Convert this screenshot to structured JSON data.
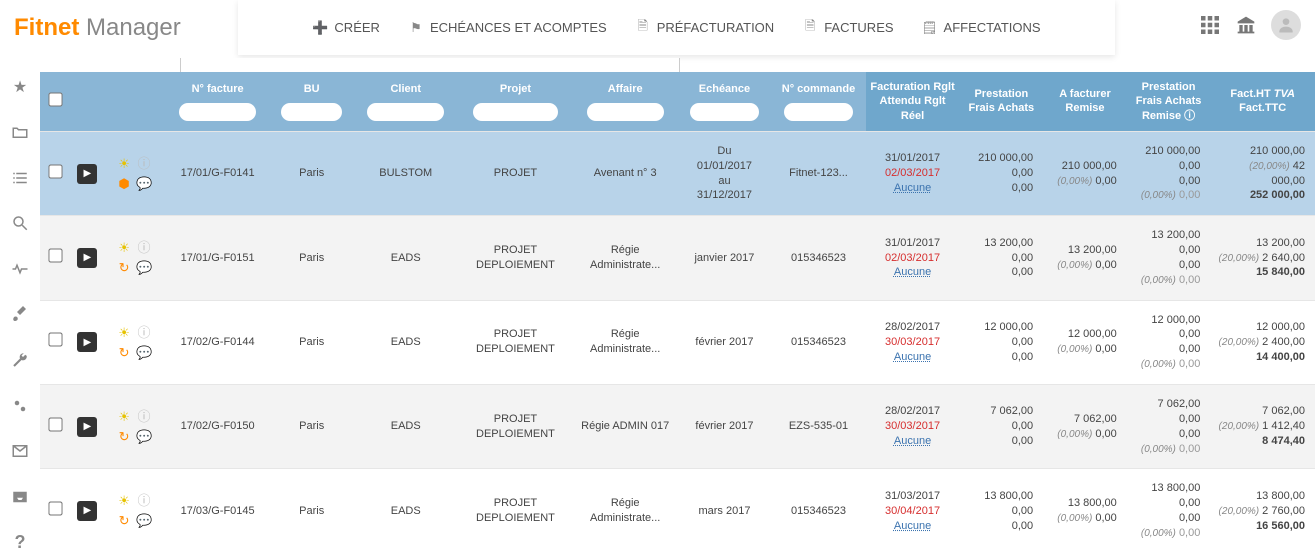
{
  "logo": {
    "brand1": "Fitnet",
    "brand2": "Manager"
  },
  "topnav": {
    "creer": "CRÉER",
    "echeances": "ECHÉANCES ET ACOMPTES",
    "prefacturation": "PRÉFACTURATION",
    "factures": "FACTURES",
    "affectations": "AFFECTATIONS"
  },
  "headers": {
    "numFacture": "N° facture",
    "bu": "BU",
    "client": "Client",
    "projet": "Projet",
    "affaire": "Affaire",
    "echeance": "Echéance",
    "numCommande": "N° commande",
    "facturation_l1": "Facturation",
    "facturation_l2": "Rglt Attendu",
    "facturation_l3": "Rglt Réel",
    "presta_l1": "Prestation",
    "presta_l2": "Frais",
    "presta_l3": "Achats",
    "afacturer_l1": "A facturer",
    "afacturer_l2": "Remise",
    "presta2_l1": "Prestation",
    "presta2_l2": "Frais",
    "presta2_l3": "Achats",
    "presta2_l4": "Remise",
    "ht_l1": "Fact.HT",
    "ht_l2": "TVA",
    "ht_l3": "Fact.TTC"
  },
  "rows": [
    {
      "selected": true,
      "iconMode": "cube",
      "numFacture": "17/01/G-F0141",
      "bu": "Paris",
      "client": "BULSTOM",
      "projet": "PROJET",
      "affaire": "Avenant n° 3",
      "echeance_l1": "Du",
      "echeance_l2": "01/01/2017",
      "echeance_l3": "au",
      "echeance_l4": "31/12/2017",
      "numCommande": "Fitnet-123...",
      "fact_l1": "31/01/2017",
      "fact_l2": "02/03/2017",
      "fact_l3": "Aucune",
      "presta_l1": "210 000,00",
      "presta_l2": "0,00",
      "presta_l3": "0,00",
      "afact_l1": "210 000,00",
      "afact_l2_pct": "(0,00%)",
      "afact_l2": "0,00",
      "p2_l1": "210 000,00",
      "p2_l2": "0,00",
      "p2_l3": "0,00",
      "p2_l4_pct": "(0,00%)",
      "p2_l4": "0,00",
      "ht_l1": "210 000,00",
      "ht_l2_pct": "(20,00%)",
      "ht_l2": "42 000,00",
      "ht_l3": "252 000,00"
    },
    {
      "selected": false,
      "iconMode": "clock",
      "numFacture": "17/01/G-F0151",
      "bu": "Paris",
      "client": "EADS",
      "projet": "PROJET DEPLOIEMENT",
      "affaire": "Régie Administrate...",
      "echeance_l2": "janvier 2017",
      "numCommande": "015346523",
      "fact_l1": "31/01/2017",
      "fact_l2": "02/03/2017",
      "fact_l3": "Aucune",
      "presta_l1": "13 200,00",
      "presta_l2": "0,00",
      "presta_l3": "0,00",
      "afact_l1": "13 200,00",
      "afact_l2_pct": "(0,00%)",
      "afact_l2": "0,00",
      "p2_l1": "13 200,00",
      "p2_l2": "0,00",
      "p2_l3": "0,00",
      "p2_l4_pct": "(0,00%)",
      "p2_l4": "0,00",
      "ht_l1": "13 200,00",
      "ht_l2_pct": "(20,00%)",
      "ht_l2": "2 640,00",
      "ht_l3": "15 840,00"
    },
    {
      "selected": false,
      "iconMode": "clock",
      "numFacture": "17/02/G-F0144",
      "bu": "Paris",
      "client": "EADS",
      "projet": "PROJET DEPLOIEMENT",
      "affaire": "Régie Administrate...",
      "echeance_l2": "février 2017",
      "numCommande": "015346523",
      "fact_l1": "28/02/2017",
      "fact_l2": "30/03/2017",
      "fact_l3": "Aucune",
      "presta_l1": "12 000,00",
      "presta_l2": "0,00",
      "presta_l3": "0,00",
      "afact_l1": "12 000,00",
      "afact_l2_pct": "(0,00%)",
      "afact_l2": "0,00",
      "p2_l1": "12 000,00",
      "p2_l2": "0,00",
      "p2_l3": "0,00",
      "p2_l4_pct": "(0,00%)",
      "p2_l4": "0,00",
      "ht_l1": "12 000,00",
      "ht_l2_pct": "(20,00%)",
      "ht_l2": "2 400,00",
      "ht_l3": "14 400,00"
    },
    {
      "selected": false,
      "iconMode": "clock",
      "numFacture": "17/02/G-F0150",
      "bu": "Paris",
      "client": "EADS",
      "projet": "PROJET DEPLOIEMENT",
      "affaire": "Régie ADMIN 017",
      "echeance_l2": "février 2017",
      "numCommande": "EZS-535-01",
      "fact_l1": "28/02/2017",
      "fact_l2": "30/03/2017",
      "fact_l3": "Aucune",
      "presta_l1": "7 062,00",
      "presta_l2": "0,00",
      "presta_l3": "0,00",
      "afact_l1": "7 062,00",
      "afact_l2_pct": "(0,00%)",
      "afact_l2": "0,00",
      "p2_l1": "7 062,00",
      "p2_l2": "0,00",
      "p2_l3": "0,00",
      "p2_l4_pct": "(0,00%)",
      "p2_l4": "0,00",
      "ht_l1": "7 062,00",
      "ht_l2_pct": "(20,00%)",
      "ht_l2": "1 412,40",
      "ht_l3": "8 474,40"
    },
    {
      "selected": false,
      "iconMode": "clock",
      "numFacture": "17/03/G-F0145",
      "bu": "Paris",
      "client": "EADS",
      "projet": "PROJET DEPLOIEMENT",
      "affaire": "Régie Administrate...",
      "echeance_l2": "mars 2017",
      "numCommande": "015346523",
      "fact_l1": "31/03/2017",
      "fact_l2": "30/04/2017",
      "fact_l3": "Aucune",
      "presta_l1": "13 800,00",
      "presta_l2": "0,00",
      "presta_l3": "0,00",
      "afact_l1": "13 800,00",
      "afact_l2_pct": "(0,00%)",
      "afact_l2": "0,00",
      "p2_l1": "13 800,00",
      "p2_l2": "0,00",
      "p2_l3": "0,00",
      "p2_l4_pct": "(0,00%)",
      "p2_l4": "0,00",
      "ht_l1": "13 800,00",
      "ht_l2_pct": "(20,00%)",
      "ht_l2": "2 760,00",
      "ht_l3": "16 560,00"
    }
  ]
}
